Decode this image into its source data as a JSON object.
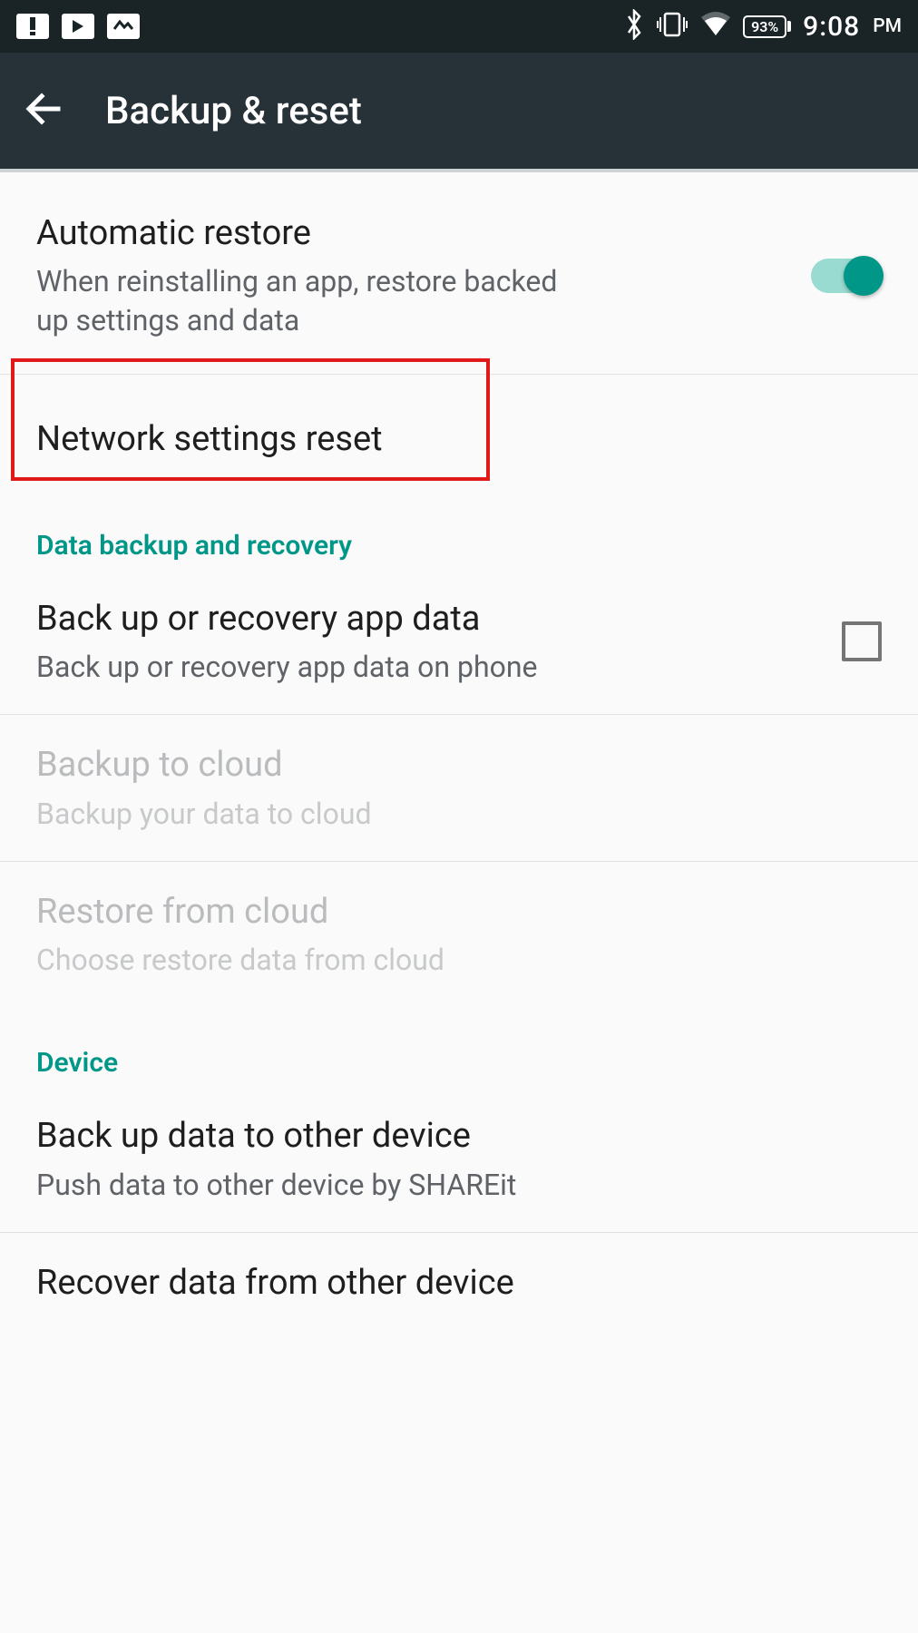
{
  "statusbar": {
    "battery_pct": "93%",
    "time": "9:08",
    "meridiem": "PM"
  },
  "appbar": {
    "title": "Backup & reset"
  },
  "rows": {
    "auto_restore": {
      "title": "Automatic restore",
      "sub": "When reinstalling an app, restore backed up settings and data"
    },
    "network_reset": {
      "title": "Network settings reset"
    },
    "section_data": "Data backup and recovery",
    "backup_app": {
      "title": "Back up or recovery app data",
      "sub": "Back up or recovery app data on phone"
    },
    "backup_cloud": {
      "title": "Backup to cloud",
      "sub": "Backup your data to cloud"
    },
    "restore_cloud": {
      "title": "Restore from cloud",
      "sub": "Choose restore data from cloud"
    },
    "section_device": "Device",
    "backup_other": {
      "title": "Back up data to other device",
      "sub": "Push data to other device by SHAREit"
    },
    "recover_other": {
      "title": "Recover data from other device"
    }
  }
}
